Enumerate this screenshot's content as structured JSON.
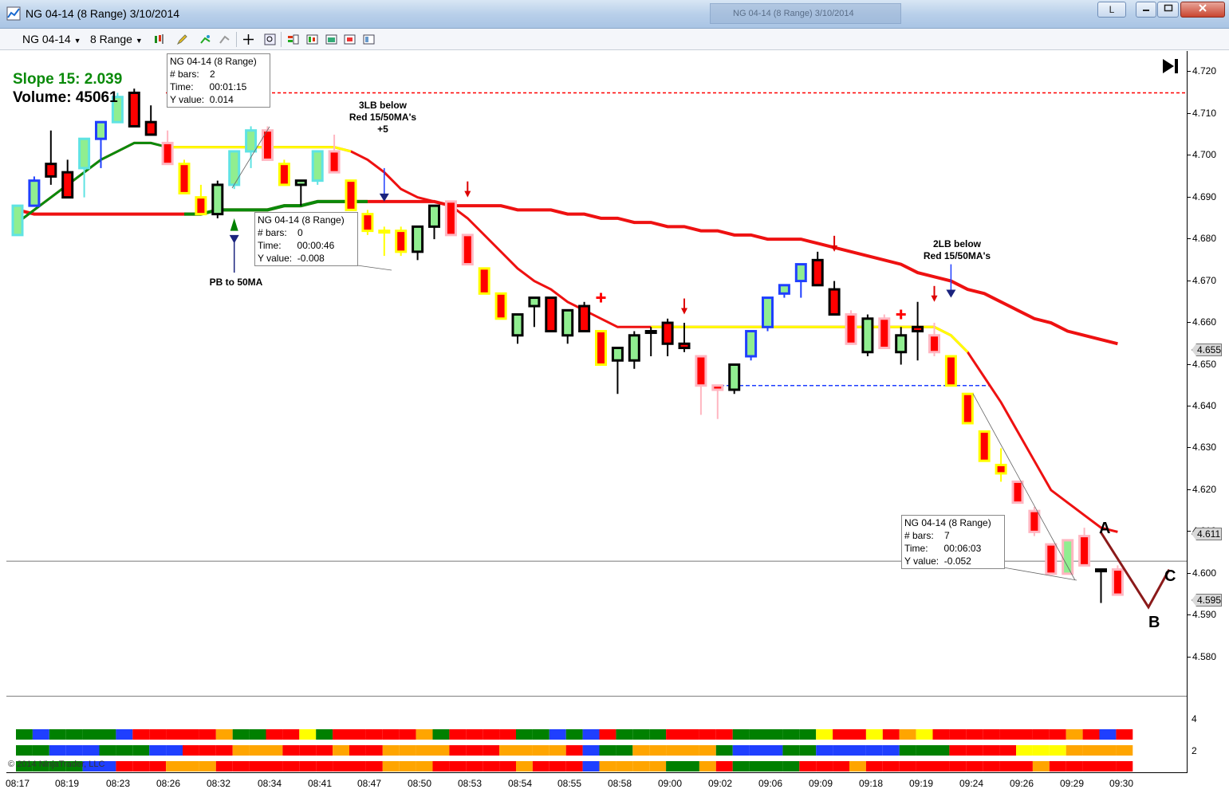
{
  "window": {
    "title": "NG 04-14 (8 Range)  3/10/2014",
    "ghost_title": "NG 04-14 (8 Range)  3/10/2014",
    "link_button_label": "L"
  },
  "toolbar": {
    "instrument": "NG 04-14",
    "period": "8 Range",
    "icons": [
      "bar-type-icon",
      "pencil-draw-icon",
      "indicator-add-icon",
      "strategy-icon",
      "crosshair-icon",
      "zoom-icon",
      "data-box-icon",
      "chart-trader-icon",
      "templates-icon",
      "properties-icon"
    ]
  },
  "header": {
    "slope_label": "Slope 15: 2.039",
    "volume_label": "Volume: 45061"
  },
  "colors": {
    "up_green": "#90ee90",
    "down_red": "#ff0000",
    "cyan": "#5fe3e3",
    "yellow": "#ffff00",
    "pink": "#ffb6c1",
    "blue": "#1f3fff",
    "orange": "#ffa500",
    "ma_red": "#ee1111",
    "ma_green": "#0a8a0a",
    "dark_green": "#008000"
  },
  "annotations": {
    "lb3": [
      "3LB below",
      "Red 15/50MA's",
      "+5"
    ],
    "lb2": [
      "2LB below",
      "Red 15/50MA's"
    ],
    "pb": "PB to 50MA",
    "abc": [
      "A",
      "B",
      "C"
    ]
  },
  "info_boxes": [
    {
      "title": "NG 04-14 (8 Range)",
      "rows": [
        "# bars:    2",
        "Time:      00:01:15",
        "Y value:  0.014"
      ]
    },
    {
      "title": "NG 04-14 (8 Range)",
      "rows": [
        "# bars:    0",
        "Time:      00:00:46",
        "Y value:  -0.008"
      ]
    },
    {
      "title": "NG 04-14 (8 Range)",
      "rows": [
        "# bars:    7",
        "Time:      00:06:03",
        "Y value:  -0.052"
      ]
    }
  ],
  "price_badges": [
    "4.655",
    "4.611",
    "4.595"
  ],
  "indicator_ticks": [
    "4",
    "2"
  ],
  "copyright": "© 2014 NinjaTrader, LLC",
  "chart_data": {
    "type": "candlestick",
    "instrument": "NG 04-14",
    "period": "8 Range",
    "date": "3/10/2014",
    "ylim": [
      4.571,
      4.725
    ],
    "y_ticks": [
      "4.720",
      "4.710",
      "4.700",
      "4.690",
      "4.680",
      "4.670",
      "4.660",
      "4.650",
      "4.640",
      "4.630",
      "4.620",
      "4.610",
      "4.600",
      "4.590",
      "4.580"
    ],
    "x_tick_labels": [
      "08:17",
      "08:19",
      "08:23",
      "08:26",
      "08:32",
      "08:34",
      "08:41",
      "08:47",
      "08:50",
      "08:53",
      "08:54",
      "08:55",
      "08:58",
      "09:00",
      "09:02",
      "09:06",
      "09:09",
      "09:18",
      "09:19",
      "09:24",
      "09:26",
      "09:29",
      "09:30"
    ],
    "candles": [
      {
        "o": 4.681,
        "h": 4.688,
        "l": 4.681,
        "c": 4.688,
        "style": "cyan-green"
      },
      {
        "o": 4.688,
        "h": 4.695,
        "l": 4.688,
        "c": 4.694,
        "style": "blue-green"
      },
      {
        "o": 4.698,
        "h": 4.706,
        "l": 4.693,
        "c": 4.695,
        "style": "black-red"
      },
      {
        "o": 4.696,
        "h": 4.699,
        "l": 4.69,
        "c": 4.69,
        "style": "black-red"
      },
      {
        "o": 4.697,
        "h": 4.7,
        "l": 4.69,
        "c": 4.704,
        "style": "cyan-green"
      },
      {
        "o": 4.704,
        "h": 4.708,
        "l": 4.697,
        "c": 4.708,
        "style": "blue-green"
      },
      {
        "o": 4.708,
        "h": 4.715,
        "l": 4.708,
        "c": 4.714,
        "style": "cyan-green"
      },
      {
        "o": 4.715,
        "h": 4.716,
        "l": 4.707,
        "c": 4.707,
        "style": "black-red"
      },
      {
        "o": 4.708,
        "h": 4.712,
        "l": 4.705,
        "c": 4.705,
        "style": "black-red"
      },
      {
        "o": 4.703,
        "h": 4.706,
        "l": 4.698,
        "c": 4.698,
        "style": "pink-red"
      },
      {
        "o": 4.698,
        "h": 4.699,
        "l": 4.691,
        "c": 4.691,
        "style": "yellow-red"
      },
      {
        "o": 4.69,
        "h": 4.693,
        "l": 4.686,
        "c": 4.686,
        "style": "yellow-red"
      },
      {
        "o": 4.686,
        "h": 4.694,
        "l": 4.685,
        "c": 4.693,
        "style": "black-green"
      },
      {
        "o": 4.693,
        "h": 4.701,
        "l": 4.692,
        "c": 4.701,
        "style": "cyan-green"
      },
      {
        "o": 4.701,
        "h": 4.707,
        "l": 4.697,
        "c": 4.706,
        "style": "cyan-green"
      },
      {
        "o": 4.706,
        "h": 4.707,
        "l": 4.699,
        "c": 4.699,
        "style": "pink-red"
      },
      {
        "o": 4.698,
        "h": 4.699,
        "l": 4.693,
        "c": 4.693,
        "style": "yellow-red"
      },
      {
        "o": 4.693,
        "h": 4.694,
        "l": 4.688,
        "c": 4.694,
        "style": "black-green"
      },
      {
        "o": 4.694,
        "h": 4.701,
        "l": 4.693,
        "c": 4.701,
        "style": "cyan-green"
      },
      {
        "o": 4.701,
        "h": 4.705,
        "l": 4.697,
        "c": 4.696,
        "style": "pink-red"
      },
      {
        "o": 4.694,
        "h": 4.694,
        "l": 4.687,
        "c": 4.687,
        "style": "yellow-red"
      },
      {
        "o": 4.686,
        "h": 4.687,
        "l": 4.681,
        "c": 4.682,
        "style": "yellow-red"
      },
      {
        "o": 4.682,
        "h": 4.683,
        "l": 4.676,
        "c": 4.682,
        "style": "yellow-green"
      },
      {
        "o": 4.682,
        "h": 4.683,
        "l": 4.676,
        "c": 4.677,
        "style": "yellow-red"
      },
      {
        "o": 4.677,
        "h": 4.683,
        "l": 4.675,
        "c": 4.683,
        "style": "black-green"
      },
      {
        "o": 4.683,
        "h": 4.688,
        "l": 4.68,
        "c": 4.688,
        "style": "black-green"
      },
      {
        "o": 4.689,
        "h": 4.689,
        "l": 4.681,
        "c": 4.681,
        "style": "pink-red"
      },
      {
        "o": 4.681,
        "h": 4.681,
        "l": 4.674,
        "c": 4.674,
        "style": "pink-red"
      },
      {
        "o": 4.673,
        "h": 4.673,
        "l": 4.667,
        "c": 4.667,
        "style": "yellow-red"
      },
      {
        "o": 4.667,
        "h": 4.667,
        "l": 4.661,
        "c": 4.661,
        "style": "yellow-red"
      },
      {
        "o": 4.662,
        "h": 4.662,
        "l": 4.655,
        "c": 4.657,
        "style": "black-green"
      },
      {
        "o": 4.664,
        "h": 4.666,
        "l": 4.659,
        "c": 4.666,
        "style": "black-green"
      },
      {
        "o": 4.666,
        "h": 4.666,
        "l": 4.658,
        "c": 4.658,
        "style": "black-red"
      },
      {
        "o": 4.657,
        "h": 4.663,
        "l": 4.655,
        "c": 4.663,
        "style": "black-green"
      },
      {
        "o": 4.664,
        "h": 4.665,
        "l": 4.658,
        "c": 4.658,
        "style": "black-red"
      },
      {
        "o": 4.658,
        "h": 4.658,
        "l": 4.65,
        "c": 4.65,
        "style": "yellow-red"
      },
      {
        "o": 4.651,
        "h": 4.654,
        "l": 4.643,
        "c": 4.654,
        "style": "black-green"
      },
      {
        "o": 4.651,
        "h": 4.658,
        "l": 4.649,
        "c": 4.657,
        "style": "black-green"
      },
      {
        "o": 4.658,
        "h": 4.659,
        "l": 4.652,
        "c": 4.658,
        "style": "black-green"
      },
      {
        "o": 4.66,
        "h": 4.661,
        "l": 4.652,
        "c": 4.655,
        "style": "black-red"
      },
      {
        "o": 4.655,
        "h": 4.66,
        "l": 4.653,
        "c": 4.654,
        "style": "black-red"
      },
      {
        "o": 4.652,
        "h": 4.652,
        "l": 4.638,
        "c": 4.645,
        "style": "pink-red"
      },
      {
        "o": 4.645,
        "h": 4.645,
        "l": 4.637,
        "c": 4.644,
        "style": "pink-red"
      },
      {
        "o": 4.644,
        "h": 4.65,
        "l": 4.643,
        "c": 4.65,
        "style": "black-green"
      },
      {
        "o": 4.652,
        "h": 4.658,
        "l": 4.651,
        "c": 4.658,
        "style": "blue-green"
      },
      {
        "o": 4.659,
        "h": 4.666,
        "l": 4.658,
        "c": 4.666,
        "style": "blue-green"
      },
      {
        "o": 4.667,
        "h": 4.669,
        "l": 4.666,
        "c": 4.669,
        "style": "blue-green"
      },
      {
        "o": 4.67,
        "h": 4.674,
        "l": 4.666,
        "c": 4.674,
        "style": "blue-green"
      },
      {
        "o": 4.675,
        "h": 4.677,
        "l": 4.669,
        "c": 4.669,
        "style": "black-red"
      },
      {
        "o": 4.668,
        "h": 4.67,
        "l": 4.662,
        "c": 4.662,
        "style": "black-red"
      },
      {
        "o": 4.662,
        "h": 4.663,
        "l": 4.656,
        "c": 4.655,
        "style": "pink-red"
      },
      {
        "o": 4.653,
        "h": 4.662,
        "l": 4.652,
        "c": 4.661,
        "style": "black-green"
      },
      {
        "o": 4.661,
        "h": 4.662,
        "l": 4.654,
        "c": 4.654,
        "style": "pink-red"
      },
      {
        "o": 4.653,
        "h": 4.659,
        "l": 4.65,
        "c": 4.657,
        "style": "black-green"
      },
      {
        "o": 4.659,
        "h": 4.665,
        "l": 4.651,
        "c": 4.658,
        "style": "black-red"
      },
      {
        "o": 4.657,
        "h": 4.66,
        "l": 4.652,
        "c": 4.653,
        "style": "pink-red"
      },
      {
        "o": 4.652,
        "h": 4.652,
        "l": 4.645,
        "c": 4.645,
        "style": "yellow-red"
      },
      {
        "o": 4.643,
        "h": 4.643,
        "l": 4.636,
        "c": 4.636,
        "style": "yellow-red"
      },
      {
        "o": 4.634,
        "h": 4.634,
        "l": 4.627,
        "c": 4.627,
        "style": "yellow-red"
      },
      {
        "o": 4.626,
        "h": 4.63,
        "l": 4.622,
        "c": 4.624,
        "style": "yellow-red"
      },
      {
        "o": 4.622,
        "h": 4.622,
        "l": 4.617,
        "c": 4.617,
        "style": "pink-red"
      },
      {
        "o": 4.615,
        "h": 4.616,
        "l": 4.609,
        "c": 4.61,
        "style": "pink-red"
      },
      {
        "o": 4.607,
        "h": 4.607,
        "l": 4.6,
        "c": 4.6,
        "style": "pink-red"
      },
      {
        "o": 4.6,
        "h": 4.608,
        "l": 4.6,
        "c": 4.608,
        "style": "pink-green"
      },
      {
        "o": 4.609,
        "h": 4.611,
        "l": 4.602,
        "c": 4.602,
        "style": "pink-red"
      },
      {
        "o": 4.601,
        "h": 4.601,
        "l": 4.593,
        "c": 4.601,
        "style": "black-green"
      },
      {
        "o": 4.601,
        "h": 4.602,
        "l": 4.595,
        "c": 4.595,
        "style": "pink-red"
      }
    ],
    "ma_fast_15": [
      4.684,
      4.687,
      4.69,
      4.693,
      4.696,
      4.699,
      4.701,
      4.703,
      4.703,
      4.702,
      4.702,
      4.702,
      4.702,
      4.702,
      4.702,
      4.702,
      4.702,
      4.702,
      4.702,
      4.702,
      4.701,
      4.699,
      4.696,
      4.692,
      4.69,
      4.689,
      4.688,
      4.685,
      4.681,
      4.677,
      4.673,
      4.67,
      4.668,
      4.665,
      4.663,
      4.661,
      4.659,
      4.659,
      4.659,
      4.659,
      4.659,
      4.659,
      4.659,
      4.659,
      4.659,
      4.659,
      4.659,
      4.659,
      4.659,
      4.659,
      4.659,
      4.659,
      4.659,
      4.659,
      4.659,
      4.659,
      4.657,
      4.653,
      4.647,
      4.641,
      4.634,
      4.627,
      4.62,
      4.617,
      4.614,
      4.611,
      4.61
    ],
    "ma_slow_50": [
      4.687,
      4.686,
      4.686,
      4.686,
      4.686,
      4.686,
      4.686,
      4.686,
      4.686,
      4.686,
      4.686,
      4.686,
      4.687,
      4.687,
      4.687,
      4.687,
      4.688,
      4.688,
      4.689,
      4.689,
      4.689,
      4.689,
      4.689,
      4.689,
      4.689,
      4.689,
      4.688,
      4.688,
      4.688,
      4.688,
      4.687,
      4.687,
      4.687,
      4.686,
      4.686,
      4.685,
      4.685,
      4.684,
      4.684,
      4.683,
      4.683,
      4.682,
      4.682,
      4.681,
      4.681,
      4.68,
      4.68,
      4.68,
      4.679,
      4.678,
      4.677,
      4.676,
      4.675,
      4.674,
      4.672,
      4.671,
      4.67,
      4.668,
      4.667,
      4.665,
      4.663,
      4.661,
      4.66,
      4.658,
      4.657,
      4.656,
      4.655
    ],
    "levels": {
      "red_dashed": 4.715,
      "blue_dashed": 4.645,
      "grey_line": 4.603
    },
    "indicator_rows": [
      [
        "#008000",
        "#1f3fff",
        "#008000",
        "#008000",
        "#008000",
        "#008000",
        "#1f3fff",
        "#ff0000",
        "#ff0000",
        "#ff0000",
        "#ff0000",
        "#ff0000",
        "#ffa500",
        "#008000",
        "#008000",
        "#ff0000",
        "#ff0000",
        "#ffff00",
        "#008000",
        "#ff0000",
        "#ff0000",
        "#ff0000",
        "#ff0000",
        "#ff0000",
        "#ffa500",
        "#008000",
        "#ff0000",
        "#ff0000",
        "#ff0000",
        "#ff0000",
        "#008000",
        "#008000",
        "#1f3fff",
        "#008000",
        "#1f3fff",
        "#ff0000",
        "#008000",
        "#008000",
        "#008000",
        "#ff0000",
        "#ff0000",
        "#ff0000",
        "#ff0000",
        "#008000",
        "#008000",
        "#008000",
        "#008000",
        "#008000",
        "#ffff00",
        "#ff0000",
        "#ff0000",
        "#ffff00",
        "#ff0000",
        "#ffa500",
        "#ffff00",
        "#ff0000",
        "#ff0000",
        "#ff0000",
        "#ff0000",
        "#ff0000",
        "#ff0000",
        "#ff0000",
        "#ff0000",
        "#ffa500",
        "#ff0000",
        "#1f3fff",
        "#ff0000"
      ],
      [
        "#008000",
        "#008000",
        "#1f3fff",
        "#1f3fff",
        "#1f3fff",
        "#008000",
        "#008000",
        "#008000",
        "#1f3fff",
        "#1f3fff",
        "#ff0000",
        "#ff0000",
        "#ff0000",
        "#ffa500",
        "#ffa500",
        "#ffa500",
        "#ff0000",
        "#ff0000",
        "#ff0000",
        "#ffa500",
        "#ff0000",
        "#ff0000",
        "#ffa500",
        "#ffa500",
        "#ffa500",
        "#ffa500",
        "#ff0000",
        "#ff0000",
        "#ff0000",
        "#ffa500",
        "#ffa500",
        "#ffa500",
        "#ffa500",
        "#ff0000",
        "#1f3fff",
        "#008000",
        "#008000",
        "#ffa500",
        "#ffa500",
        "#ffa500",
        "#ffa500",
        "#ffa500",
        "#008000",
        "#1f3fff",
        "#1f3fff",
        "#1f3fff",
        "#008000",
        "#008000",
        "#1f3fff",
        "#1f3fff",
        "#1f3fff",
        "#1f3fff",
        "#1f3fff",
        "#008000",
        "#008000",
        "#008000",
        "#ff0000",
        "#ff0000",
        "#ff0000",
        "#ff0000",
        "#ffff00",
        "#ffff00",
        "#ffff00",
        "#ffa500",
        "#ffa500",
        "#ffa500",
        "#ffa500"
      ],
      [
        "#008000",
        "#008000",
        "#008000",
        "#008000",
        "#1f3fff",
        "#1f3fff",
        "#ff0000",
        "#ff0000",
        "#ff0000",
        "#ffa500",
        "#ffa500",
        "#ffa500",
        "#ff0000",
        "#ff0000",
        "#ff0000",
        "#ff0000",
        "#ff0000",
        "#ff0000",
        "#ff0000",
        "#ff0000",
        "#ff0000",
        "#ff0000",
        "#ffa500",
        "#ffa500",
        "#ffa500",
        "#ff0000",
        "#ff0000",
        "#ff0000",
        "#ff0000",
        "#ff0000",
        "#ffa500",
        "#ff0000",
        "#ff0000",
        "#ff0000",
        "#1f3fff",
        "#ffa500",
        "#ffa500",
        "#ffa500",
        "#ffa500",
        "#008000",
        "#008000",
        "#ffa500",
        "#ff0000",
        "#008000",
        "#008000",
        "#008000",
        "#008000",
        "#ff0000",
        "#ff0000",
        "#ff0000",
        "#ffa500",
        "#ff0000",
        "#ff0000",
        "#ff0000",
        "#ff0000",
        "#ff0000",
        "#ff0000",
        "#ff0000",
        "#ff0000",
        "#ff0000",
        "#ff0000",
        "#ffa500",
        "#ff0000",
        "#ff0000",
        "#ff0000",
        "#ff0000",
        "#ff0000"
      ]
    ]
  }
}
